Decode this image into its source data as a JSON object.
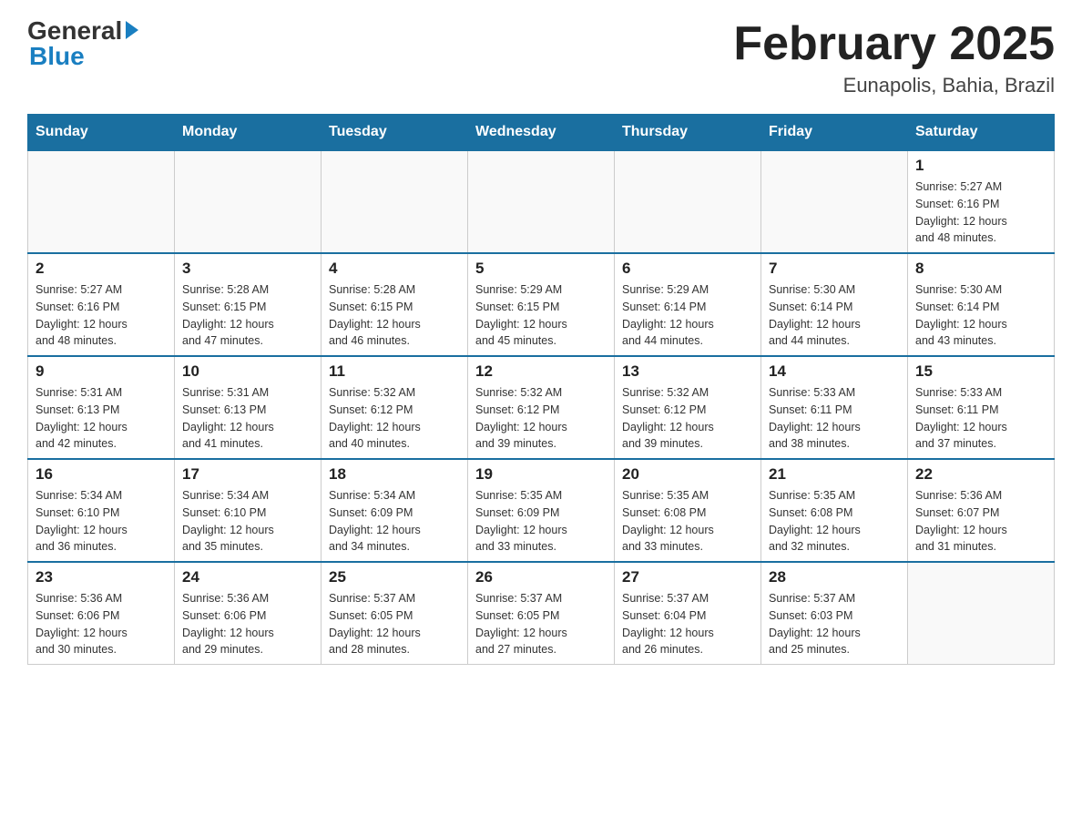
{
  "header": {
    "logo_general": "General",
    "logo_blue": "Blue",
    "title": "February 2025",
    "subtitle": "Eunapolis, Bahia, Brazil"
  },
  "days_of_week": [
    "Sunday",
    "Monday",
    "Tuesday",
    "Wednesday",
    "Thursday",
    "Friday",
    "Saturday"
  ],
  "weeks": [
    {
      "days": [
        {
          "num": "",
          "info": ""
        },
        {
          "num": "",
          "info": ""
        },
        {
          "num": "",
          "info": ""
        },
        {
          "num": "",
          "info": ""
        },
        {
          "num": "",
          "info": ""
        },
        {
          "num": "",
          "info": ""
        },
        {
          "num": "1",
          "info": "Sunrise: 5:27 AM\nSunset: 6:16 PM\nDaylight: 12 hours\nand 48 minutes."
        }
      ]
    },
    {
      "days": [
        {
          "num": "2",
          "info": "Sunrise: 5:27 AM\nSunset: 6:16 PM\nDaylight: 12 hours\nand 48 minutes."
        },
        {
          "num": "3",
          "info": "Sunrise: 5:28 AM\nSunset: 6:15 PM\nDaylight: 12 hours\nand 47 minutes."
        },
        {
          "num": "4",
          "info": "Sunrise: 5:28 AM\nSunset: 6:15 PM\nDaylight: 12 hours\nand 46 minutes."
        },
        {
          "num": "5",
          "info": "Sunrise: 5:29 AM\nSunset: 6:15 PM\nDaylight: 12 hours\nand 45 minutes."
        },
        {
          "num": "6",
          "info": "Sunrise: 5:29 AM\nSunset: 6:14 PM\nDaylight: 12 hours\nand 44 minutes."
        },
        {
          "num": "7",
          "info": "Sunrise: 5:30 AM\nSunset: 6:14 PM\nDaylight: 12 hours\nand 44 minutes."
        },
        {
          "num": "8",
          "info": "Sunrise: 5:30 AM\nSunset: 6:14 PM\nDaylight: 12 hours\nand 43 minutes."
        }
      ]
    },
    {
      "days": [
        {
          "num": "9",
          "info": "Sunrise: 5:31 AM\nSunset: 6:13 PM\nDaylight: 12 hours\nand 42 minutes."
        },
        {
          "num": "10",
          "info": "Sunrise: 5:31 AM\nSunset: 6:13 PM\nDaylight: 12 hours\nand 41 minutes."
        },
        {
          "num": "11",
          "info": "Sunrise: 5:32 AM\nSunset: 6:12 PM\nDaylight: 12 hours\nand 40 minutes."
        },
        {
          "num": "12",
          "info": "Sunrise: 5:32 AM\nSunset: 6:12 PM\nDaylight: 12 hours\nand 39 minutes."
        },
        {
          "num": "13",
          "info": "Sunrise: 5:32 AM\nSunset: 6:12 PM\nDaylight: 12 hours\nand 39 minutes."
        },
        {
          "num": "14",
          "info": "Sunrise: 5:33 AM\nSunset: 6:11 PM\nDaylight: 12 hours\nand 38 minutes."
        },
        {
          "num": "15",
          "info": "Sunrise: 5:33 AM\nSunset: 6:11 PM\nDaylight: 12 hours\nand 37 minutes."
        }
      ]
    },
    {
      "days": [
        {
          "num": "16",
          "info": "Sunrise: 5:34 AM\nSunset: 6:10 PM\nDaylight: 12 hours\nand 36 minutes."
        },
        {
          "num": "17",
          "info": "Sunrise: 5:34 AM\nSunset: 6:10 PM\nDaylight: 12 hours\nand 35 minutes."
        },
        {
          "num": "18",
          "info": "Sunrise: 5:34 AM\nSunset: 6:09 PM\nDaylight: 12 hours\nand 34 minutes."
        },
        {
          "num": "19",
          "info": "Sunrise: 5:35 AM\nSunset: 6:09 PM\nDaylight: 12 hours\nand 33 minutes."
        },
        {
          "num": "20",
          "info": "Sunrise: 5:35 AM\nSunset: 6:08 PM\nDaylight: 12 hours\nand 33 minutes."
        },
        {
          "num": "21",
          "info": "Sunrise: 5:35 AM\nSunset: 6:08 PM\nDaylight: 12 hours\nand 32 minutes."
        },
        {
          "num": "22",
          "info": "Sunrise: 5:36 AM\nSunset: 6:07 PM\nDaylight: 12 hours\nand 31 minutes."
        }
      ]
    },
    {
      "days": [
        {
          "num": "23",
          "info": "Sunrise: 5:36 AM\nSunset: 6:06 PM\nDaylight: 12 hours\nand 30 minutes."
        },
        {
          "num": "24",
          "info": "Sunrise: 5:36 AM\nSunset: 6:06 PM\nDaylight: 12 hours\nand 29 minutes."
        },
        {
          "num": "25",
          "info": "Sunrise: 5:37 AM\nSunset: 6:05 PM\nDaylight: 12 hours\nand 28 minutes."
        },
        {
          "num": "26",
          "info": "Sunrise: 5:37 AM\nSunset: 6:05 PM\nDaylight: 12 hours\nand 27 minutes."
        },
        {
          "num": "27",
          "info": "Sunrise: 5:37 AM\nSunset: 6:04 PM\nDaylight: 12 hours\nand 26 minutes."
        },
        {
          "num": "28",
          "info": "Sunrise: 5:37 AM\nSunset: 6:03 PM\nDaylight: 12 hours\nand 25 minutes."
        },
        {
          "num": "",
          "info": ""
        }
      ]
    }
  ]
}
